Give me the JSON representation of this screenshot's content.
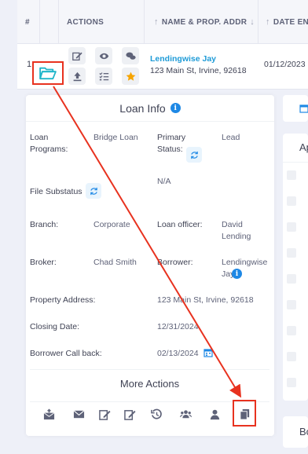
{
  "table": {
    "columns": {
      "hash": "#",
      "actions": "ACTIONS",
      "name": "NAME & PROP. ADDR",
      "date": "DATE EN"
    },
    "row": {
      "number": "1",
      "borrower_name": "Lendingwise Jay",
      "property_address": "123 Main St, Irvine, 92618",
      "date": "01/12/2023"
    }
  },
  "loan_info": {
    "title": "Loan Info",
    "loan_programs_label": "Loan Programs:",
    "loan_programs_value": "Bridge Loan",
    "primary_status_label": "Primary Status:",
    "primary_status_value": "Lead",
    "file_substatus_label": "File Substatus",
    "file_substatus_value": "N/A",
    "branch_label": "Branch:",
    "branch_value": "Corporate",
    "loan_officer_label": "Loan officer:",
    "loan_officer_value": "David Lending",
    "broker_label": "Broker:",
    "broker_value": "Chad Smith",
    "borrower_label": "Borrower:",
    "borrower_value": "Lendingwise Jay",
    "property_address_label": "Property Address:",
    "property_address_value": "123 Main St, Irvine, 92618",
    "closing_date_label": "Closing Date:",
    "closing_date_value": "12/31/2024",
    "borrower_callback_label": "Borrower Call back:",
    "borrower_callback_value": "02/13/2024"
  },
  "more_actions": {
    "title": "More Actions",
    "buttons": [
      "mail-upload-icon",
      "envelope-icon",
      "edit-document-icon",
      "edit-note-icon",
      "history-icon",
      "users-icon",
      "user-icon",
      "copy-icon"
    ]
  },
  "right_panels": {
    "panel2_title": "Ap",
    "panel3_title": "Bo"
  },
  "colors": {
    "accent_link": "#1e9bd7",
    "highlight": "#e8321f",
    "info": "#1e88e5",
    "star": "#f6a400",
    "folder": "#1fb5c9"
  }
}
